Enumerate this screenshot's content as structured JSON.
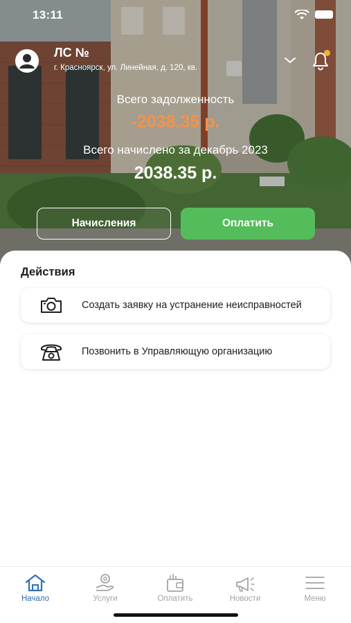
{
  "status_bar": {
    "time": "13:11"
  },
  "account": {
    "title": "ЛС №",
    "address": "г. Красноярск, ул. Линейная, д. 120, кв.",
    "icons": [
      "user-icon",
      "chevron-down-icon",
      "bell-icon"
    ],
    "notification_dot_color": "#f2b233"
  },
  "summary": {
    "debt_label": "Всего задолженность",
    "debt_amount": "-2038.35 р.",
    "accrued_label": "Всего начислено за декабрь 2023",
    "accrued_amount": "2038.35 р.",
    "debt_color": "#f5924a"
  },
  "buttons": {
    "charges": "Начисления",
    "pay": "Оплатить",
    "pay_color": "#54bc5a"
  },
  "actions": {
    "title": "Действия",
    "items": [
      {
        "label": "Создать заявку на устранение неисправностей",
        "icon": "camera-icon"
      },
      {
        "label": "Позвонить в Управляющую организацию",
        "icon": "phone-icon"
      }
    ]
  },
  "tabbar": {
    "active_color": "#2e6fb3",
    "items": [
      {
        "label": "Начало",
        "icon": "home-icon",
        "active": true
      },
      {
        "label": "Услуги",
        "icon": "services-icon",
        "active": false
      },
      {
        "label": "Оплатить",
        "icon": "wallet-icon",
        "active": false
      },
      {
        "label": "Новости",
        "icon": "megaphone-icon",
        "active": false
      },
      {
        "label": "Меню",
        "icon": "menu-icon",
        "active": false
      }
    ]
  }
}
